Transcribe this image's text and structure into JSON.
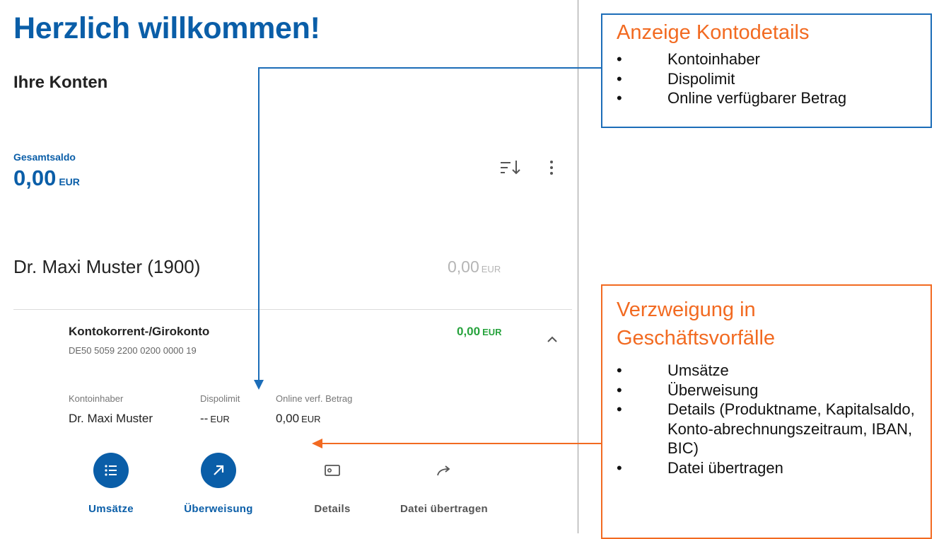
{
  "app": {
    "welcome_title": "Herzlich willkommen!",
    "section_title": "Ihre Konten",
    "total": {
      "label": "Gesamtsaldo",
      "value": "0,00",
      "currency": "EUR"
    },
    "owner_group": {
      "name": "Dr. Maxi Muster (1900)",
      "value": "0,00",
      "currency": "EUR"
    },
    "account": {
      "name": "Kontokorrent-/Girokonto",
      "iban": "DE50 5059 2200 0200 0000 19",
      "balance": "0,00",
      "currency": "EUR",
      "details": [
        {
          "label": "Kontoinhaber",
          "value": "Dr. Maxi Muster",
          "currency": ""
        },
        {
          "label": "Dispolimit",
          "value": "--",
          "currency": "EUR"
        },
        {
          "label": "Online verf. Betrag",
          "value": "0,00",
          "currency": "EUR"
        }
      ],
      "actions": [
        {
          "label": "Umsätze",
          "icon": "list-icon"
        },
        {
          "label": "Überweisung",
          "icon": "arrow-up-right-icon"
        },
        {
          "label": "Details",
          "icon": "card-icon"
        },
        {
          "label": "Datei übertragen",
          "icon": "share-arrow-icon"
        }
      ]
    },
    "icons": {
      "sort": "sort-icon",
      "more": "more-vertical-icon",
      "collapse": "chevron-up-icon"
    }
  },
  "callouts": {
    "account_details": {
      "title": "Anzeige Kontodetails",
      "items": [
        "Kontoinhaber",
        "Dispolimit",
        "Online verfügbarer Betrag"
      ]
    },
    "transactions": {
      "title_line1": "Verzweigung in",
      "title_line2": "Geschäftsvorfälle",
      "items": [
        "Umsätze",
        "Überweisung",
        "Details (Produktname, Kapitalsaldo, Konto-abrechnungszeitraum, IBAN, BIC)",
        "Datei übertragen"
      ]
    }
  },
  "colors": {
    "primary_blue": "#0a5ea8",
    "positive_green": "#27a33d",
    "callout_orange": "#f26a21",
    "callout_blue": "#1c6db8"
  }
}
